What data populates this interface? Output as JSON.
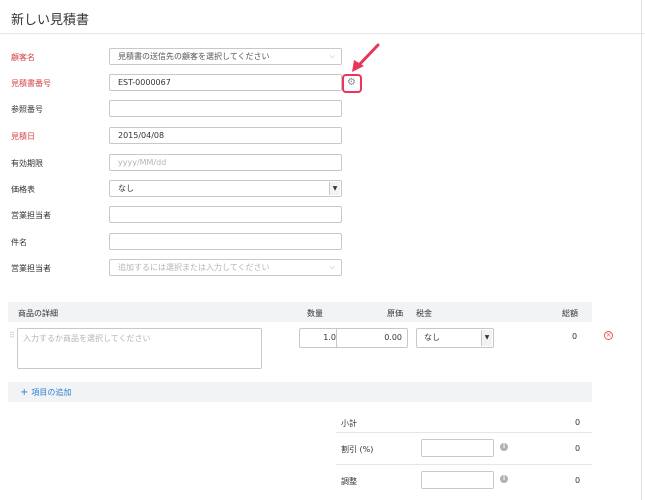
{
  "page": {
    "title": "新しい見積書"
  },
  "form": {
    "customer": {
      "label": "顧客名",
      "placeholder": "見積書の送信先の顧客を選択してください"
    },
    "estimate_number": {
      "label": "見積書番号",
      "value": "EST-0000067"
    },
    "reference": {
      "label": "参照番号",
      "value": ""
    },
    "estimate_date": {
      "label": "見積日",
      "value": "2015/04/08"
    },
    "expiry_date": {
      "label": "有効期限",
      "placeholder": "yyyy/MM/dd"
    },
    "price_list": {
      "label": "価格表",
      "value": "なし"
    },
    "salesperson": {
      "label": "営業担当者",
      "value": ""
    },
    "subject": {
      "label": "件名",
      "value": ""
    },
    "salesperson2": {
      "label": "営業担当者",
      "placeholder": "追加するには選択または入力してください"
    }
  },
  "items_table": {
    "headers": {
      "item": "商品の詳細",
      "qty": "数量",
      "rate": "原価",
      "tax": "税金",
      "amount": "総額"
    },
    "row": {
      "placeholder": "入力するか商品を選択してください",
      "qty": "1.00",
      "rate": "0.00",
      "tax": "なし",
      "amount": "0"
    },
    "add_label": "項目の追加"
  },
  "summary": {
    "subtotal": {
      "label": "小計",
      "value": "0"
    },
    "discount": {
      "label": "割引 (%)",
      "value": "0"
    },
    "adjustment": {
      "label": "調整",
      "value": "0"
    }
  },
  "colors": {
    "required": "#d43f3f",
    "highlight": "#e8375a",
    "link": "#2a7fd4"
  },
  "icons": {
    "settings": "gear-icon",
    "remove": "close-circle-icon",
    "info": "info-icon",
    "arrow": "pointer-arrow"
  }
}
